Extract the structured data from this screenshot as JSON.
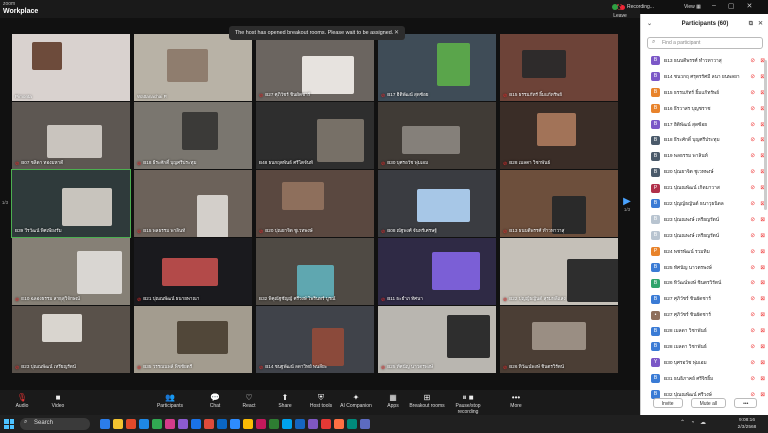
{
  "app": {
    "brand_top": "zoom",
    "brand_name": "Workplace"
  },
  "topbar": {
    "recording": "Recording...",
    "view": "View"
  },
  "banner": {
    "text": "The host has opened breakout rooms. Please wait to be assigned.",
    "close": "✕"
  },
  "grid": {
    "page_left": "1/3",
    "page_right": "1/3",
    "tiles": [
      {
        "name": "Pimonta",
        "mic": false,
        "bg": "#d9d2cf",
        "accent": "#6d4b3b"
      },
      {
        "name": "Wattanachai P.",
        "mic": false,
        "bg": "#b8b2a6",
        "accent": "#8f7d6e"
      },
      {
        "name": "B27 ศุภิวัชร์ ชินผัดชาร์",
        "mic": true,
        "bg": "#6b6560",
        "accent": "#e7e3df"
      },
      {
        "name": "B17 ฮิติพัฒน์ สุดซ้อย",
        "mic": true,
        "bg": "#3f4c57",
        "accent": "#5aa54b"
      },
      {
        "name": "B15 ธรรมภัทร์ ยิ้มแก้ทรัพย์",
        "mic": true,
        "bg": "#6d4338",
        "accent": "#2e2b2b"
      },
      {
        "name": "B07 ชลิดา ทองมหาดี",
        "mic": true,
        "bg": "#5d5752",
        "accent": "#c9c4be"
      },
      {
        "name": "B18 ธีระศักดิ์ บุญศรีประทุม",
        "mic": true,
        "bg": "#7a766f",
        "accent": "#3b3a38"
      },
      {
        "name": "B48 ธนกฤตพันธ์ ศรีโตจันท์",
        "mic": false,
        "bg": "#2e2e2e",
        "accent": "#777067"
      },
      {
        "name": "B30 บุศรอวัช พุ่มเอม",
        "mic": true,
        "bg": "#403b36",
        "accent": "#85807a"
      },
      {
        "name": "B28 เมลดา วิชาพันธ์",
        "mic": true,
        "bg": "#3a2d27",
        "accent": "#a27358"
      },
      {
        "name": "B39 วีรวัฒน์ พิศเพียงรัม",
        "mic": false,
        "bg": "#2f3a3b",
        "accent": "#c8c4bd"
      },
      {
        "name": "B15 พลธรรม พาลินท์",
        "mic": true,
        "bg": "#6c625a",
        "accent": "#d3cfca"
      },
      {
        "name": "B20 ปุณยาจิต ชูเวทพงษ์",
        "mic": true,
        "bg": "#5a4840",
        "accent": "#8e6f5c"
      },
      {
        "name": "B08 ณัฐพงศ์ จันทร์เศรษฐ์",
        "mic": true,
        "bg": "#3a3c41",
        "accent": "#a7c7e7"
      },
      {
        "name": "B13 ธนบดีพรรศ์ ทำวทาวาสุ",
        "mic": true,
        "bg": "#6d4f3c",
        "accent": "#2a2a2a"
      },
      {
        "name": "E10 ฉลองธรรม สาธุสุวิจักษณ์",
        "mic": true,
        "bg": "#868076",
        "accent": "#d9d6d2"
      },
      {
        "name": "B21 ปุณณพัฒน์ ธนายพาณา",
        "mic": true,
        "bg": "#1a1a1e",
        "accent": "#b34a49"
      },
      {
        "name": "B32 พิคุณัฐชัญญ์ ศรีวงษ์ ไพรินทร์ บูรณ์",
        "mic": false,
        "bg": "#4f4a44",
        "accent": "#5fa7b0"
      },
      {
        "name": "B11 ธะยำภ ทัศนา",
        "mic": true,
        "bg": "#2f2a45",
        "accent": "#7b5fd6"
      },
      {
        "name": "B22 ปุญญ์ธญันต์ สุรมหลีแสง",
        "mic": true,
        "bg": "#c5c0b8",
        "accent": "#2e2e2e"
      },
      {
        "name": "B23 ปุณณพัฒน์ เหรียญรัตน์",
        "mic": true,
        "bg": "#59514a",
        "accent": "#d9d5cf"
      },
      {
        "name": "B35 วรรณนพล์ พิชชัยตรี",
        "mic": true,
        "bg": "#a39c8f",
        "accent": "#514739"
      },
      {
        "name": "B14 ชนฐพัฒน์ ลดาวิทย์ พนลียะ",
        "mic": true,
        "bg": "#40434a",
        "accent": "#8b4a3b"
      },
      {
        "name": "B25 ทัศนัญ นาวตรพงษ์",
        "mic": true,
        "bg": "#b9b6b0",
        "accent": "#2e2e2e"
      },
      {
        "name": "B26 ทิวัฒน์พงษ์ ชินตรวิรัตน์",
        "mic": true,
        "bg": "#4b3e35",
        "accent": "#9a8e83"
      }
    ]
  },
  "toolbar": {
    "items": [
      {
        "label": "Audio",
        "icon": "microphone-muted-icon",
        "glyph": "🎙",
        "red": true
      },
      {
        "label": "Video",
        "icon": "camera-icon",
        "glyph": "■",
        "red": false
      },
      {
        "label": "Participants",
        "icon": "people-icon",
        "glyph": "👥",
        "red": false,
        "badge": "60"
      },
      {
        "label": "Chat",
        "icon": "chat-icon",
        "glyph": "💬",
        "red": false
      },
      {
        "label": "React",
        "icon": "heart-icon",
        "glyph": "♡",
        "red": false
      },
      {
        "label": "Share",
        "icon": "share-icon",
        "glyph": "⬆",
        "red": false
      },
      {
        "label": "Host tools",
        "icon": "shield-icon",
        "glyph": "⛨",
        "red": false
      },
      {
        "label": "AI Companion",
        "icon": "sparkle-icon",
        "glyph": "✦",
        "red": false
      },
      {
        "label": "Apps",
        "icon": "apps-icon",
        "glyph": "▦",
        "red": false
      },
      {
        "label": "Breakout rooms",
        "icon": "breakout-rooms-icon",
        "glyph": "⊞",
        "red": false,
        "badge": "2"
      },
      {
        "label": "Pause/stop recording",
        "icon": "pause-stop-icon",
        "glyph": "⏸ ■",
        "red": false
      },
      {
        "label": "More",
        "icon": "more-icon",
        "glyph": "•••",
        "red": false
      }
    ],
    "leave": "Leave"
  },
  "panel": {
    "title": "Participants (60)",
    "search_placeholder": "Find a participant",
    "participants": [
      {
        "name": "B13 ธนบดีพรรศ์ ทำวทาวาสุ",
        "initial": "B",
        "color": "#7b57c7"
      },
      {
        "name": "B14 ชนวกฤ ศรุตรรัศมี ลนา ยนพลยา",
        "initial": "B",
        "color": "#7b57c7"
      },
      {
        "name": "B15 ธรรมภัทร์ ยิ้มแก้ทรัพย์",
        "initial": "B",
        "color": "#e8832b"
      },
      {
        "name": "B16 ธีรวาสร บุญชราช",
        "initial": "B",
        "color": "#e8832b"
      },
      {
        "name": "B17 ฮิติพัฒน์ สุดซ้อย",
        "initial": "B",
        "color": "#7b57c7"
      },
      {
        "name": "B18 ธีระศักดิ์ บุญศรีประทุม",
        "initial": "B",
        "color": "#4a5a6a"
      },
      {
        "name": "B19 พลธรรม พาลินท์",
        "initial": "B",
        "color": "#4a5a6a"
      },
      {
        "name": "B20 ปุณยาจิต ชูเวทพงษ์",
        "initial": "B",
        "color": "#4a5a6a"
      },
      {
        "name": "B21 ปุณณพัฒน์ เกิดมาวาส",
        "initial": "P",
        "color": "#b0304a"
      },
      {
        "name": "B22 ปุญญ์ธญันต์ ธนาวุธนิดล",
        "initial": "B",
        "color": "#3a7bd5"
      },
      {
        "name": "B23 ปุณณพงษ์ เหรียญรัตน์",
        "initial": "B",
        "color": "#b8c4d0"
      },
      {
        "name": "B23 ปุณณพงษ์ เหรียญรัตน์",
        "initial": "B",
        "color": "#b8c4d0"
      },
      {
        "name": "B24 พชรพัฒน์ รวมทิม",
        "initial": "P",
        "color": "#e8832b"
      },
      {
        "name": "B25 ทัศนัญ นาวตรพงษ์",
        "initial": "B",
        "color": "#3a7bd5"
      },
      {
        "name": "B26 ทิวัฒน์พงษ์ ชินตรวิรัตน์",
        "initial": "B",
        "color": "#2fa46b"
      },
      {
        "name": "B27 ศุภิวัชร์ ชินผัดชาร์",
        "initial": "B",
        "color": "#3a7bd5"
      },
      {
        "name": "B27 ศุภิวัชร์ ชินผัดชาร์",
        "initial": "•",
        "color": "#8e6f5c"
      },
      {
        "name": "B28 เมลดา วิชาพันธ์",
        "initial": "B",
        "color": "#3a7bd5"
      },
      {
        "name": "B28 เมลดา วิชาพันธ์",
        "initial": "B",
        "color": "#3a7bd5"
      },
      {
        "name": "B30 บุศรอวัช พุ่มเอม",
        "initial": "Y",
        "color": "#7b57c7"
      },
      {
        "name": "B31 ธนธิภาคย์ ศรีจิรยิ้ม",
        "initial": "B",
        "color": "#3a7bd5"
      },
      {
        "name": "B32 ปุณณพัฒน์ ศรีวงษ์",
        "initial": "B",
        "color": "#3a7bd5"
      }
    ],
    "invite": "Invite",
    "mute_all": "Mute all"
  },
  "taskbar": {
    "search": "Search",
    "time": "9:08:16",
    "date": "2/3/2568",
    "apps": [
      "#2b7de9",
      "#f4c430",
      "#e24a2a",
      "#1e88e5",
      "#31a852",
      "#d43b8a",
      "#8c5bd0",
      "#1a73e8",
      "#e04b3b",
      "#0a66c2",
      "#2d8cff",
      "#fbbc05",
      "#c2185b",
      "#2e7d32",
      "#00a3ee",
      "#1565c0",
      "#7e57c2",
      "#e53935",
      "#ff7043",
      "#00897b",
      "#5c6bc0"
    ]
  }
}
